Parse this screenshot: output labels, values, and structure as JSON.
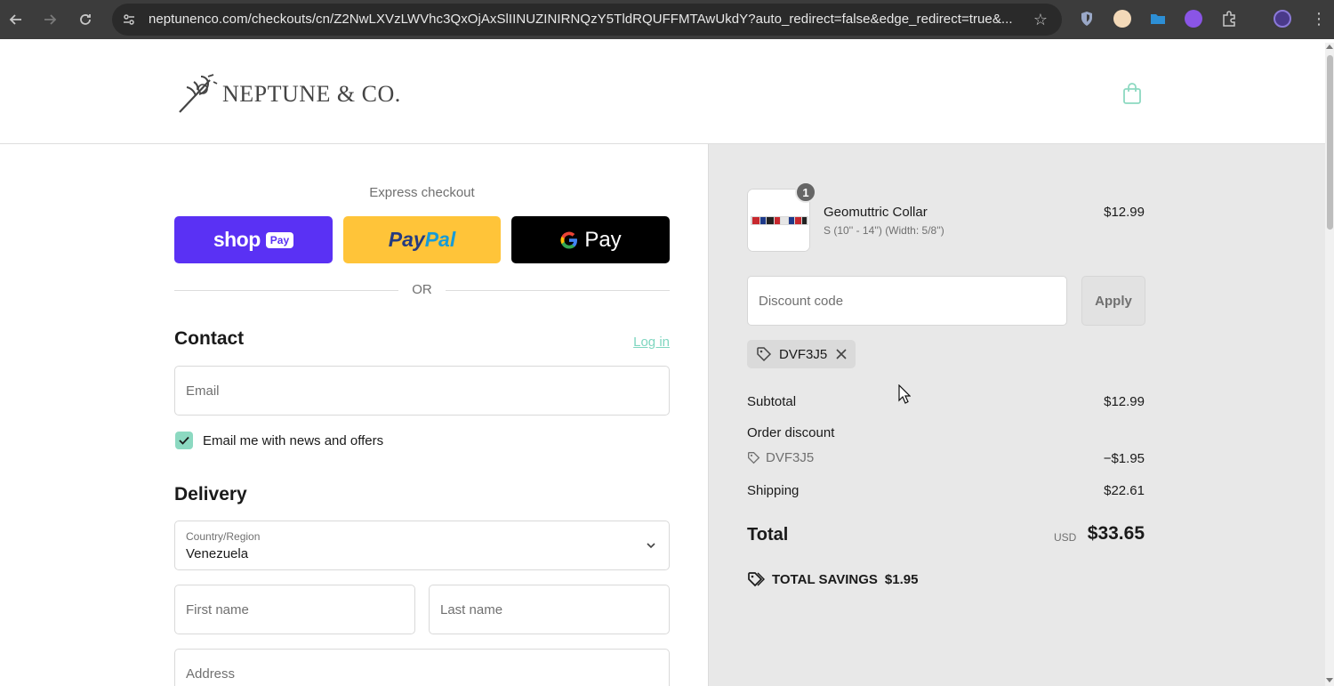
{
  "browser": {
    "url": "neptunenco.com/checkouts/cn/Z2NwLXVzLWVhc3QxOjAxSlIINUZINIRNQzY5TldRQUFFMTAwUkdY?auto_redirect=false&edge_redirect=true&..."
  },
  "brand": {
    "name": "NEPTUNE & CO."
  },
  "express": {
    "title": "Express checkout",
    "shop_word": "shop",
    "shop_badge": "Pay",
    "paypal_pay": "Pay",
    "paypal_pal": "Pal",
    "gpay_g": "G",
    "gpay_pay": "Pay",
    "or": "OR"
  },
  "contact": {
    "title": "Contact",
    "login": "Log in",
    "email_placeholder": "Email",
    "newsletter_label": "Email me with news and offers",
    "newsletter_checked": true
  },
  "delivery": {
    "title": "Delivery",
    "country_label": "Country/Region",
    "country_value": "Venezuela",
    "first_name_placeholder": "First name",
    "last_name_placeholder": "Last name",
    "address_placeholder": "Address"
  },
  "summary": {
    "item": {
      "name": "Geomuttric Collar",
      "variant": "S (10'' - 14'') (Width: 5/8'')",
      "price": "$12.99",
      "quantity": "1"
    },
    "discount_placeholder": "Discount code",
    "apply_label": "Apply",
    "applied_code": "DVF3J5",
    "subtotal_label": "Subtotal",
    "subtotal_value": "$12.99",
    "order_discount_label": "Order discount",
    "discount_code": "DVF3J5",
    "discount_value": "−$1.95",
    "shipping_label": "Shipping",
    "shipping_value": "$22.61",
    "total_label": "Total",
    "currency": "USD",
    "total_value": "$33.65",
    "savings_label": "TOTAL SAVINGS",
    "savings_value": "$1.95"
  },
  "colors": {
    "accent": "#8cd9c1",
    "shop_pay": "#5a31f4",
    "paypal": "#ffc439",
    "gpay": "#000000",
    "summary_bg": "#e8e8e8"
  }
}
